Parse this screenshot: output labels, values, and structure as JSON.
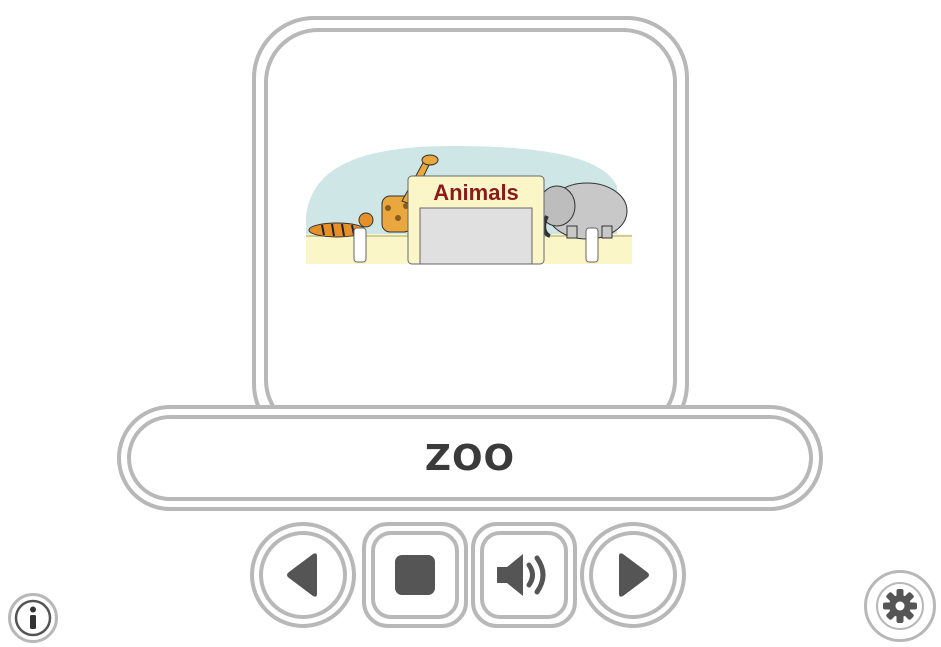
{
  "card": {
    "image_icon": "zoo-entrance-illustration",
    "sign_text": "Animals"
  },
  "word": {
    "text": "ZOO"
  },
  "controls": {
    "previous_icon": "previous-triangle-icon",
    "stop_icon": "stop-square-icon",
    "sound_icon": "speaker-icon",
    "next_icon": "next-triangle-icon"
  },
  "corner": {
    "info_icon": "info-icon",
    "settings_icon": "gear-icon"
  },
  "colors": {
    "frame": "#b8b8b8",
    "icon": "#555555",
    "sign_text": "#8b1a1a",
    "sky": "#cfe6e6",
    "ground": "#fbf6c8"
  }
}
